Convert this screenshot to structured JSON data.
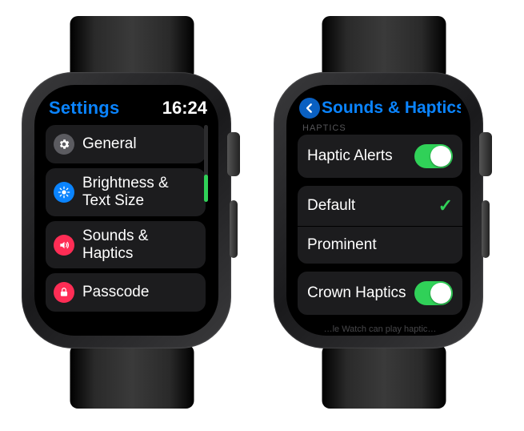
{
  "left": {
    "header": {
      "title": "Settings",
      "time": "16:24"
    },
    "items": [
      {
        "icon": "gear-icon",
        "icon_bg": "#5b5b60",
        "label": "General"
      },
      {
        "icon": "brightness-icon",
        "icon_bg": "#0a84ff",
        "label": "Brightness & Text Size"
      },
      {
        "icon": "speaker-icon",
        "icon_bg": "#ff2d55",
        "label": "Sounds & Haptics"
      },
      {
        "icon": "lock-icon",
        "icon_bg": "#ff2d55",
        "label": "Passcode"
      }
    ]
  },
  "right": {
    "header": {
      "back_icon": "chevron-left-icon",
      "title": "Sounds & Haptics"
    },
    "section_label": "HAPTICS",
    "group1": [
      {
        "label": "Haptic Alerts",
        "accessory": "toggle",
        "value": true
      }
    ],
    "group2": [
      {
        "label": "Default",
        "accessory": "check",
        "value": true
      },
      {
        "label": "Prominent",
        "accessory": "none"
      }
    ],
    "group3": [
      {
        "label": "Crown Haptics",
        "accessory": "toggle",
        "value": true
      }
    ],
    "footer": "…le Watch can play haptic…"
  },
  "colors": {
    "accent_blue": "#0a84ff",
    "accent_green": "#30d158",
    "row_bg": "#1c1c1e"
  }
}
